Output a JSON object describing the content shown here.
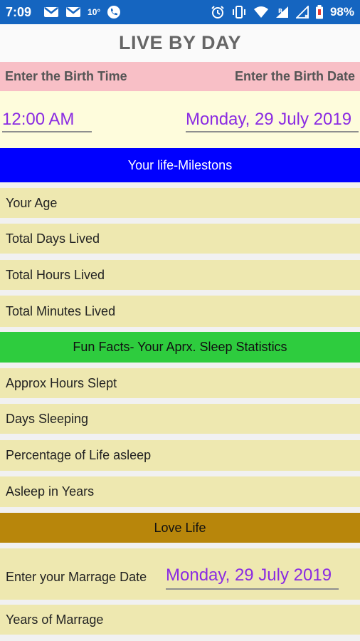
{
  "status_bar": {
    "time": "7:09",
    "temp": "10°",
    "battery": "98%",
    "network_label": "R"
  },
  "app": {
    "title": "LIVE BY DAY"
  },
  "birth": {
    "time_label": "Enter the Birth Time",
    "date_label": "Enter the Birth Date",
    "time_value": "12:00 AM",
    "date_value": "Monday, 29 July 2019"
  },
  "milestones": {
    "header": "Your life-Milestons",
    "rows": [
      "Your Age",
      "Total Days Lived",
      "Total Hours Lived",
      "Total Minutes Lived"
    ]
  },
  "sleep": {
    "header": "Fun Facts- Your Aprx. Sleep Statistics",
    "rows": [
      "Approx Hours Slept",
      "Days Sleeping",
      "Percentage of Life asleep",
      "Asleep in Years"
    ]
  },
  "love": {
    "header": "Love Life",
    "marriage_label": "Enter your Marrage Date",
    "marriage_date": "Monday, 29 July 2019",
    "years_label": "Years of Marrage"
  }
}
